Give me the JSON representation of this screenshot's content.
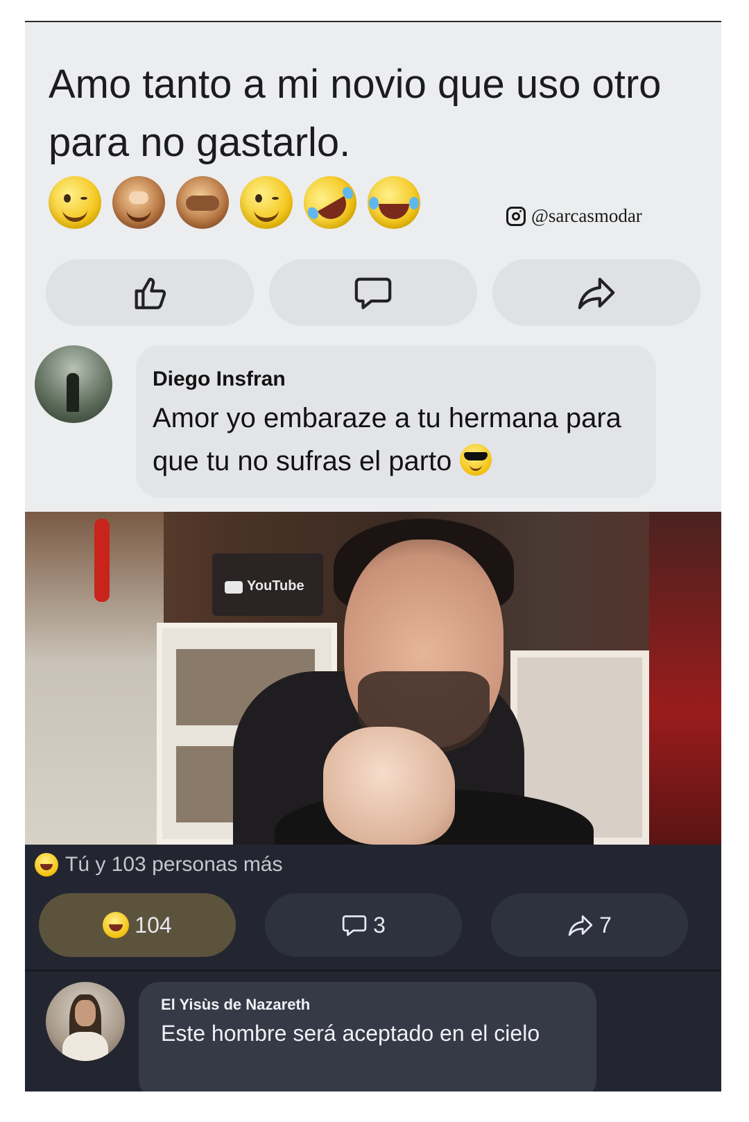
{
  "post": {
    "text": "Amo tanto a mi novio que uso otro para no gastarlo.",
    "emojis": [
      "wink-face",
      "see-no-evil-monkey",
      "see-no-evil-monkey",
      "wink-face",
      "rolling-laughing-face",
      "tears-of-joy-face"
    ]
  },
  "watermark": {
    "handle": "@sarcasmodar"
  },
  "top_actions": [
    "like",
    "comment",
    "share"
  ],
  "comment1": {
    "name": "Diego Insfran",
    "text": "Amor yo embaraze a tu hermana para que tu no sufras el parto"
  },
  "photo": {
    "channel_label": "YouTube"
  },
  "reactions": {
    "summary": "Tú y 103 personas más"
  },
  "bottom_actions": {
    "laugh_count": "104",
    "comment_count": "3",
    "share_count": "7"
  },
  "comment2": {
    "name": "El Yisùs de Nazareth",
    "text": "Este hombre será aceptado en el cielo"
  },
  "colors": {
    "dark_bg": "#232631",
    "light_bg": "#ecedef",
    "active_pill": "#5c533d"
  }
}
